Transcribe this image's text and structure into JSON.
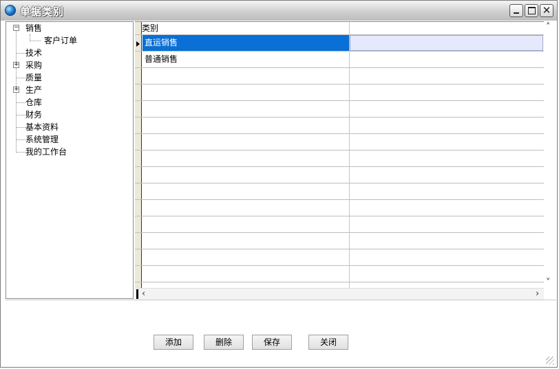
{
  "window": {
    "title": "单据类别"
  },
  "tree": {
    "items": [
      {
        "label": "销售",
        "expander": "⊟"
      },
      {
        "label": "客户订单"
      },
      {
        "label": "技术"
      },
      {
        "label": "采购",
        "expander": "⊞"
      },
      {
        "label": "质量"
      },
      {
        "label": "生产",
        "expander": "⊞"
      },
      {
        "label": "仓库"
      },
      {
        "label": "财务"
      },
      {
        "label": "基本资料"
      },
      {
        "label": "系统管理"
      },
      {
        "label": "我的工作台"
      }
    ]
  },
  "grid": {
    "column_header": "类别",
    "rows": [
      "直运销售",
      "普通销售"
    ]
  },
  "buttons": {
    "add": "添加",
    "delete": "删除",
    "save": "保存",
    "close": "关闭"
  }
}
